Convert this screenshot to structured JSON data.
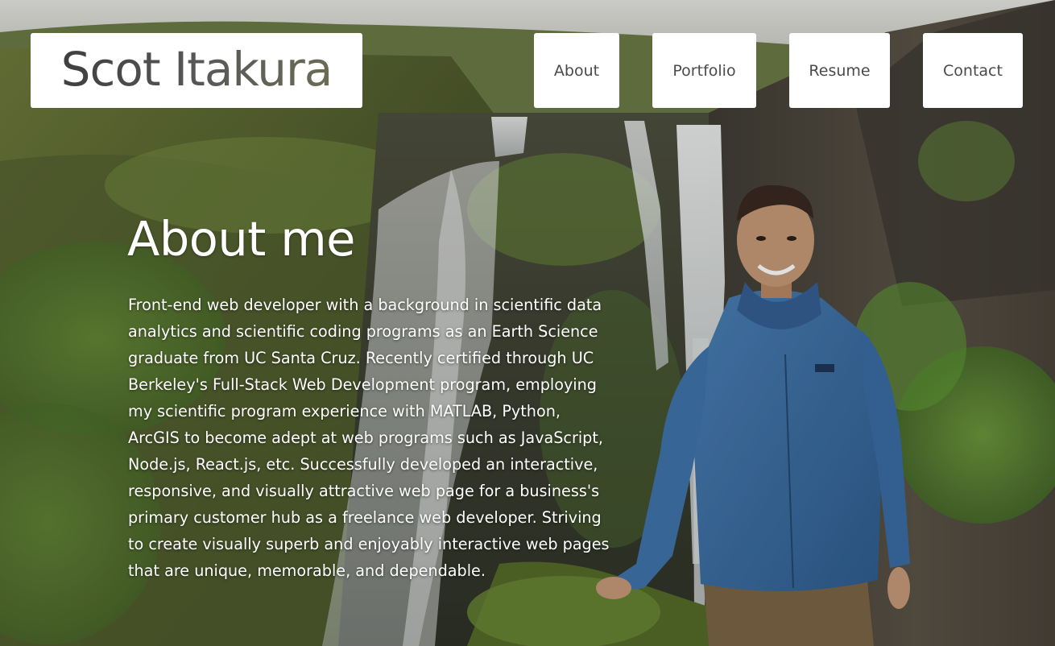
{
  "header": {
    "logo_text": "Scot Itakura"
  },
  "nav": {
    "items": [
      {
        "label": "About"
      },
      {
        "label": "Portfolio"
      },
      {
        "label": "Resume"
      },
      {
        "label": "Contact"
      }
    ]
  },
  "main": {
    "title": "About me",
    "bio": "Front-end web developer with a background in scientific data analytics and scientific coding programs as an Earth Science graduate from UC Santa Cruz. Recently certified through UC Berkeley's Full-Stack Web Development program, employing my scientific program experience with MATLAB, Python, ArcGIS to become adept at web programs such as JavaScript, Node.js, React.js, etc. Successfully developed an interactive, responsive, and visually attractive web page for a business's primary customer hub as a freelance web developer. Striving to create visually superb and enjoyably interactive web pages that are unique, memorable, and dependable."
  },
  "colors": {
    "nav_background": "#ffffff",
    "nav_text": "#4a4a4a",
    "heading_text": "#ffffff"
  }
}
